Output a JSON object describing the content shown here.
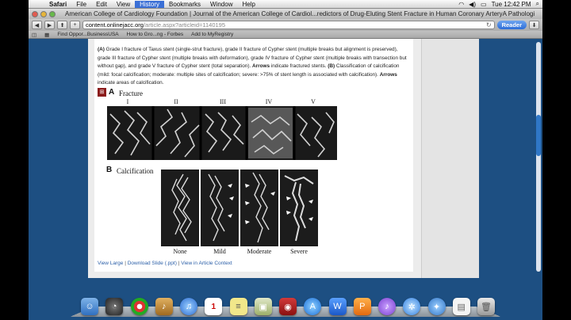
{
  "menubar": {
    "app": "Safari",
    "items": [
      "File",
      "Edit",
      "View",
      "History",
      "Bookmarks",
      "Window",
      "Help"
    ],
    "active_index": 3,
    "clock": "Tue 12:42 PM"
  },
  "window": {
    "title": "American College of Cardiology Foundation | Journal of the American College of Cardiol...redictors of Drug-Eluting Stent Fracture in Human Coronary ArteryA Pathologic Analysis"
  },
  "toolbar": {
    "url_host": "content.onlinejacc.org",
    "url_path": "/article.aspx?articleid=1140195",
    "reader_label": "Reader"
  },
  "bookmarks": [
    "Find Oppor...BusinessUSA",
    "How to Gro...ng - Forbes",
    "Add to MyRegistry"
  ],
  "caption": {
    "p1_label": "(A)",
    "p1_text": " Grade I fracture of Taxus stent (single-strut fracture), grade II fracture of Cypher stent (multiple breaks but alignment is preserved), grade III fracture of Cypher stent (multiple breaks with deformation), grade IV fracture of Cypher stent (multiple breaks with transection but without gap), and grade V fracture of Cypher stent (total separation). ",
    "arrows1": "Arrows",
    "p1_text2": " indicate fractured stents. ",
    "p2_label": "(B)",
    "p2_text": " Classification of calcification (mild: focal calcification; moderate: multiple sites of calcification; severe: >75% of stent length is associated with calcification). ",
    "arrows2": "Arrows",
    "p2_text2": " indicate areas of calcification."
  },
  "figure": {
    "panel_a_letter": "A",
    "panel_a_title": "Fracture",
    "grades": [
      "I",
      "II",
      "III",
      "IV",
      "V"
    ],
    "panel_b_letter": "B",
    "panel_b_title": "Calcification",
    "calc_labels": [
      "None",
      "Mild",
      "Moderate",
      "Severe"
    ]
  },
  "links": {
    "view_large": "View Large",
    "download": "Download Slide (.ppt)",
    "context": "View in Article Context"
  },
  "dock": {
    "icons": [
      "finder-icon",
      "dashboard-icon",
      "chrome-icon",
      "itunes-icon",
      "itunes-icon",
      "calendar-icon",
      "stickies-icon",
      "preview-icon",
      "photo-booth-icon",
      "app-store-icon",
      "word-icon",
      "powerpoint-icon",
      "itunes-icon",
      "safari-icon",
      "safari-icon",
      "file-icon",
      "trash-icon"
    ],
    "calendar_day": "1"
  }
}
